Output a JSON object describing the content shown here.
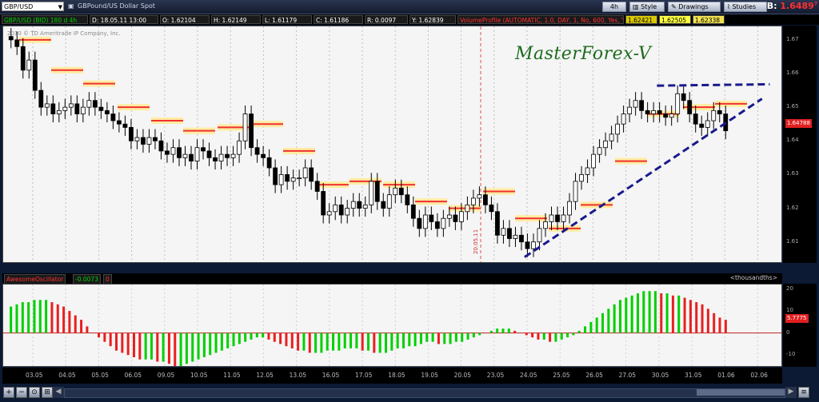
{
  "toolbar": {
    "symbol": "GBP/USD",
    "description": "GBPound/US Dollar Spot",
    "timeframe": "4h",
    "style": "Style",
    "drawings": "Drawings",
    "studies": "Studies",
    "bid_label": "B:",
    "bid_value": "1.6489",
    "bid_sup": "7",
    "change_up": "+0",
    "change_dn": "+0"
  },
  "infobar": {
    "pair": "GBP/USD (BID) 180 d 4h",
    "date": "D: 18.05.11 13:00",
    "open": "O: 1.62104",
    "high": "H: 1.62149",
    "low": "L: 1.61179",
    "close": "C: 1.61186",
    "range": "R: 0.0097",
    "y": "Y: 1.62839",
    "volprofile": "VolumeProfile (AUTOMATIC, 1.0, DAY, 1, No, 600, Yes, Yes, 70, 50)",
    "v1": "1.62421",
    "v2": "1.62505",
    "v3": "1.62338"
  },
  "watermark": "2010 © TD Ameritrade IP Company, Inc.",
  "brand": "MasterForex-V",
  "vline_date": "20.05.11",
  "price_axis": [
    "1.67",
    "1.66",
    "1.65",
    "1.64",
    "1.63",
    "1.62",
    "1.61"
  ],
  "price_flag": "1.64788",
  "oscillator": {
    "name": "AwesomeOscillator",
    "value": "-0.0073",
    "zero": "0",
    "units": "<thousandths>",
    "axis": [
      "20",
      "10",
      "0",
      "-10"
    ],
    "flag": "5.7775"
  },
  "dates": [
    "03.05",
    "04.05",
    "05.05",
    "06.05",
    "09.05",
    "10.05",
    "11.05",
    "12.05",
    "13.05",
    "16.05",
    "17.05",
    "18.05",
    "19.05",
    "20.05",
    "23.05",
    "24.05",
    "25.05",
    "26.05",
    "27.05",
    "30.05",
    "31.05",
    "01.06",
    "02.06"
  ],
  "colors": {
    "up": "#00d000",
    "down": "#e82020",
    "trend": "#1a1a8c",
    "vp": "#ff4040"
  },
  "chart_data": [
    {
      "type": "candlestick",
      "title": "GBP/USD (BID) 180 d 4h",
      "ylim": [
        1.604,
        1.674
      ],
      "closes": [
        1.67,
        1.668,
        1.661,
        1.664,
        1.655,
        1.65,
        1.651,
        1.648,
        1.649,
        1.65,
        1.651,
        1.648,
        1.65,
        1.652,
        1.65,
        1.649,
        1.648,
        1.646,
        1.645,
        1.644,
        1.64,
        1.641,
        1.639,
        1.641,
        1.64,
        1.637,
        1.636,
        1.638,
        1.635,
        1.636,
        1.634,
        1.638,
        1.637,
        1.635,
        1.634,
        1.636,
        1.635,
        1.636,
        1.64,
        1.648,
        1.638,
        1.636,
        1.635,
        1.632,
        1.627,
        1.63,
        1.628,
        1.629,
        1.629,
        1.632,
        1.628,
        1.625,
        1.618,
        1.619,
        1.621,
        1.618,
        1.62,
        1.622,
        1.62,
        1.621,
        1.628,
        1.622,
        1.62,
        1.624,
        1.626,
        1.624,
        1.621,
        1.617,
        1.614,
        1.618,
        1.616,
        1.614,
        1.617,
        1.618,
        1.616,
        1.619,
        1.621,
        1.623,
        1.624,
        1.621,
        1.619,
        1.612,
        1.614,
        1.611,
        1.612,
        1.61,
        1.608,
        1.61,
        1.614,
        1.616,
        1.618,
        1.616,
        1.618,
        1.622,
        1.628,
        1.63,
        1.632,
        1.636,
        1.638,
        1.64,
        1.642,
        1.645,
        1.648,
        1.65,
        1.652,
        1.649,
        1.648,
        1.649,
        1.648,
        1.647,
        1.648,
        1.654,
        1.652,
        1.648,
        1.645,
        1.644,
        1.646,
        1.649,
        1.648,
        1.643
      ],
      "trendline_support": [
        [
          1.6055,
          0.67
        ],
        [
          1.6525,
          0.975
        ]
      ],
      "trendline_resistance": [
        [
          1.6564,
          0.84
        ],
        [
          1.6568,
          0.985
        ]
      ]
    },
    {
      "type": "bar",
      "title": "AwesomeOscillator",
      "ylim": [
        -15,
        22
      ],
      "values": [
        12,
        13,
        14,
        14,
        15,
        15,
        15,
        14,
        13,
        12,
        10,
        8,
        6,
        3,
        0,
        -2,
        -4,
        -6,
        -8,
        -9,
        -10,
        -11,
        -12,
        -12,
        -12,
        -13,
        -13,
        -14,
        -15,
        -15,
        -14,
        -13,
        -12,
        -11,
        -10,
        -9,
        -8,
        -7,
        -6,
        -5,
        -4,
        -3,
        -2,
        -2,
        -3,
        -4,
        -5,
        -6,
        -7,
        -8,
        -8,
        -9,
        -9,
        -9,
        -8,
        -8,
        -8,
        -7,
        -7,
        -7,
        -8,
        -8,
        -9,
        -9,
        -9,
        -8,
        -7,
        -7,
        -6,
        -6,
        -5,
        -4,
        -4,
        -5,
        -5,
        -5,
        -4,
        -4,
        -3,
        -2,
        -1,
        0,
        1,
        2,
        2,
        2,
        1,
        0,
        -1,
        -2,
        -3,
        -3,
        -4,
        -4,
        -3,
        -2,
        -1,
        1,
        3,
        5,
        7,
        9,
        11,
        13,
        15,
        16,
        17,
        18,
        19,
        19,
        19,
        18,
        18,
        17,
        17,
        16,
        15,
        14,
        13,
        11,
        9,
        7,
        6
      ]
    }
  ]
}
